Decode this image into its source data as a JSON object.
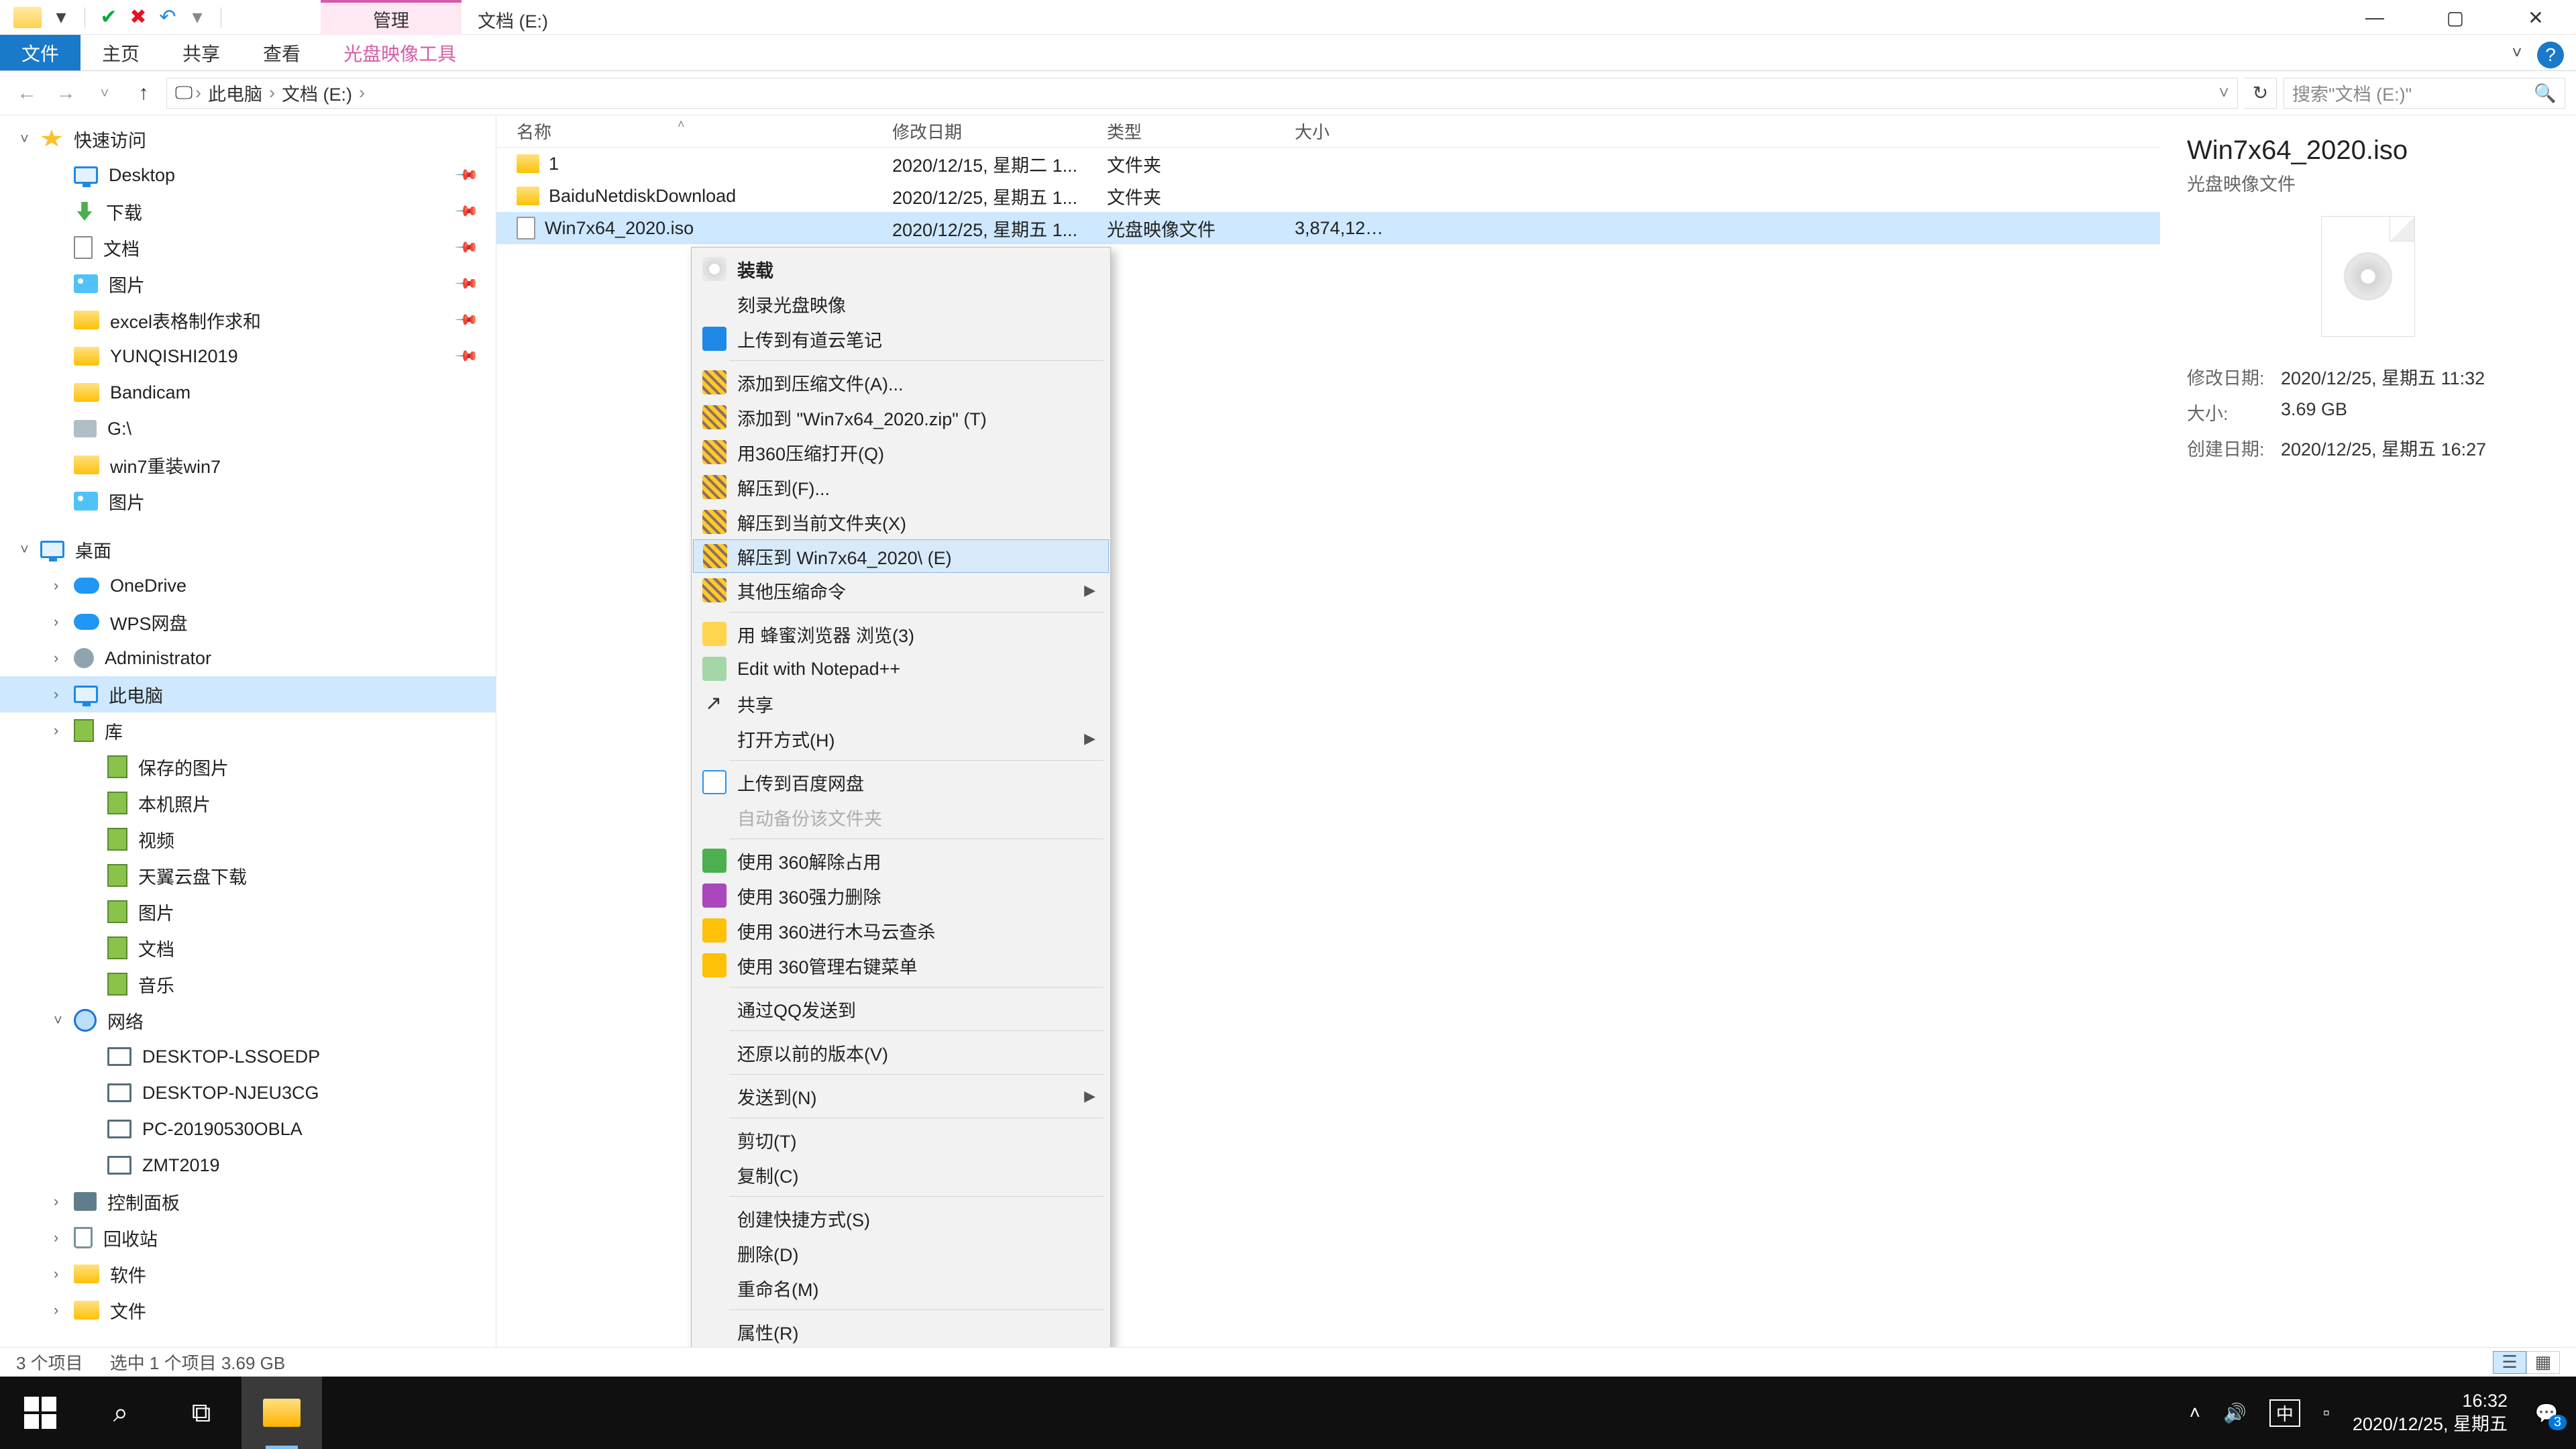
{
  "window": {
    "title": "文档 (E:)",
    "ctx_tab": "管理"
  },
  "ribbon": {
    "file": "文件",
    "tabs": [
      "主页",
      "共享",
      "查看"
    ],
    "ctx": "光盘映像工具"
  },
  "address": {
    "crumbs": [
      "此电脑",
      "文档 (E:)"
    ],
    "search_placeholder": "搜索\"文档 (E:)\""
  },
  "nav": {
    "quick": {
      "label": "快速访问",
      "items": [
        {
          "label": "Desktop",
          "pinned": true
        },
        {
          "label": "下载",
          "pinned": true
        },
        {
          "label": "文档",
          "pinned": true
        },
        {
          "label": "图片",
          "pinned": true
        },
        {
          "label": "excel表格制作求和",
          "pinned": true
        },
        {
          "label": "YUNQISHI2019",
          "pinned": true
        },
        {
          "label": "Bandicam"
        },
        {
          "label": "G:\\"
        },
        {
          "label": "win7重装win7"
        },
        {
          "label": "图片"
        }
      ]
    },
    "desktop": {
      "label": "桌面",
      "items": [
        {
          "label": "OneDrive"
        },
        {
          "label": "WPS网盘"
        },
        {
          "label": "Administrator"
        },
        {
          "label": "此电脑",
          "selected": true
        },
        {
          "label": "库"
        }
      ]
    },
    "lib_items": [
      {
        "label": "保存的图片"
      },
      {
        "label": "本机照片"
      },
      {
        "label": "视频"
      },
      {
        "label": "天翼云盘下载"
      },
      {
        "label": "图片"
      },
      {
        "label": "文档"
      },
      {
        "label": "音乐"
      }
    ],
    "network": {
      "label": "网络",
      "items": [
        {
          "label": "DESKTOP-LSSOEDP"
        },
        {
          "label": "DESKTOP-NJEU3CG"
        },
        {
          "label": "PC-20190530OBLA"
        },
        {
          "label": "ZMT2019"
        }
      ]
    },
    "extras": [
      {
        "label": "控制面板"
      },
      {
        "label": "回收站"
      },
      {
        "label": "软件"
      },
      {
        "label": "文件"
      }
    ]
  },
  "columns": {
    "name": "名称",
    "date": "修改日期",
    "type": "类型",
    "size": "大小"
  },
  "files": [
    {
      "name": "1",
      "date": "2020/12/15, 星期二 1...",
      "type": "文件夹",
      "size": "",
      "kind": "folder"
    },
    {
      "name": "BaiduNetdiskDownload",
      "date": "2020/12/25, 星期五 1...",
      "type": "文件夹",
      "size": "",
      "kind": "folder"
    },
    {
      "name": "Win7x64_2020.iso",
      "date": "2020/12/25, 星期五 1...",
      "type": "光盘映像文件",
      "size": "3,874,126...",
      "kind": "iso",
      "selected": true
    }
  ],
  "details": {
    "title": "Win7x64_2020.iso",
    "sub": "光盘映像文件",
    "rows": [
      {
        "label": "修改日期:",
        "value": "2020/12/25, 星期五 11:32"
      },
      {
        "label": "大小:",
        "value": "3.69 GB"
      },
      {
        "label": "创建日期:",
        "value": "2020/12/25, 星期五 16:27"
      }
    ]
  },
  "context_menu": [
    {
      "label": "装载",
      "icon": "mount",
      "bold": true
    },
    {
      "label": "刻录光盘映像"
    },
    {
      "label": "上传到有道云笔记",
      "icon": "note"
    },
    {
      "sep": true
    },
    {
      "label": "添加到压缩文件(A)...",
      "icon": "zip"
    },
    {
      "label": "添加到 \"Win7x64_2020.zip\" (T)",
      "icon": "zip"
    },
    {
      "label": "用360压缩打开(Q)",
      "icon": "zip"
    },
    {
      "label": "解压到(F)...",
      "icon": "zip"
    },
    {
      "label": "解压到当前文件夹(X)",
      "icon": "zip"
    },
    {
      "label": "解压到 Win7x64_2020\\ (E)",
      "icon": "zip",
      "hover": true
    },
    {
      "label": "其他压缩命令",
      "icon": "zip",
      "submenu": true
    },
    {
      "sep": true
    },
    {
      "label": "用 蜂蜜浏览器 浏览(3)",
      "icon": "bee"
    },
    {
      "label": "Edit with Notepad++",
      "icon": "npp"
    },
    {
      "label": "共享",
      "icon": "share"
    },
    {
      "label": "打开方式(H)",
      "submenu": true
    },
    {
      "sep": true
    },
    {
      "label": "上传到百度网盘",
      "icon": "baidu"
    },
    {
      "label": "自动备份该文件夹",
      "disabled": true
    },
    {
      "sep": true
    },
    {
      "label": "使用 360解除占用",
      "icon": "360"
    },
    {
      "label": "使用 360强力删除",
      "icon": "del"
    },
    {
      "label": "使用 360进行木马云查杀",
      "icon": "360y"
    },
    {
      "label": "使用 360管理右键菜单",
      "icon": "360y"
    },
    {
      "sep": true
    },
    {
      "label": "通过QQ发送到"
    },
    {
      "sep": true
    },
    {
      "label": "还原以前的版本(V)"
    },
    {
      "sep": true
    },
    {
      "label": "发送到(N)",
      "submenu": true
    },
    {
      "sep": true
    },
    {
      "label": "剪切(T)"
    },
    {
      "label": "复制(C)"
    },
    {
      "sep": true
    },
    {
      "label": "创建快捷方式(S)"
    },
    {
      "label": "删除(D)"
    },
    {
      "label": "重命名(M)"
    },
    {
      "sep": true
    },
    {
      "label": "属性(R)"
    }
  ],
  "status": {
    "count": "3 个项目",
    "selection": "选中 1 个项目  3.69 GB"
  },
  "taskbar": {
    "time": "16:32",
    "date": "2020/12/25, 星期五",
    "ime": "中",
    "notif": "3"
  }
}
